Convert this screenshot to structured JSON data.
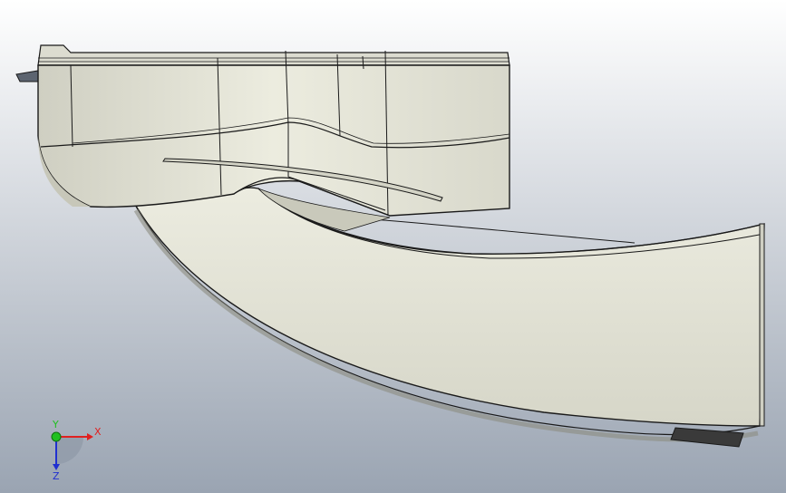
{
  "viewport": {
    "background_top": "#ffffff",
    "background_bottom": "#9aa4b2"
  },
  "model": {
    "body_color": "#e4e4d6",
    "shade_color": "#b9b9aa",
    "edge_color": "#1a1a1a"
  },
  "triad": {
    "x_label": "X",
    "y_label": "Y",
    "z_label": "Z",
    "x_color": "#e02020",
    "y_color": "#20c020",
    "z_color": "#2030d0"
  }
}
